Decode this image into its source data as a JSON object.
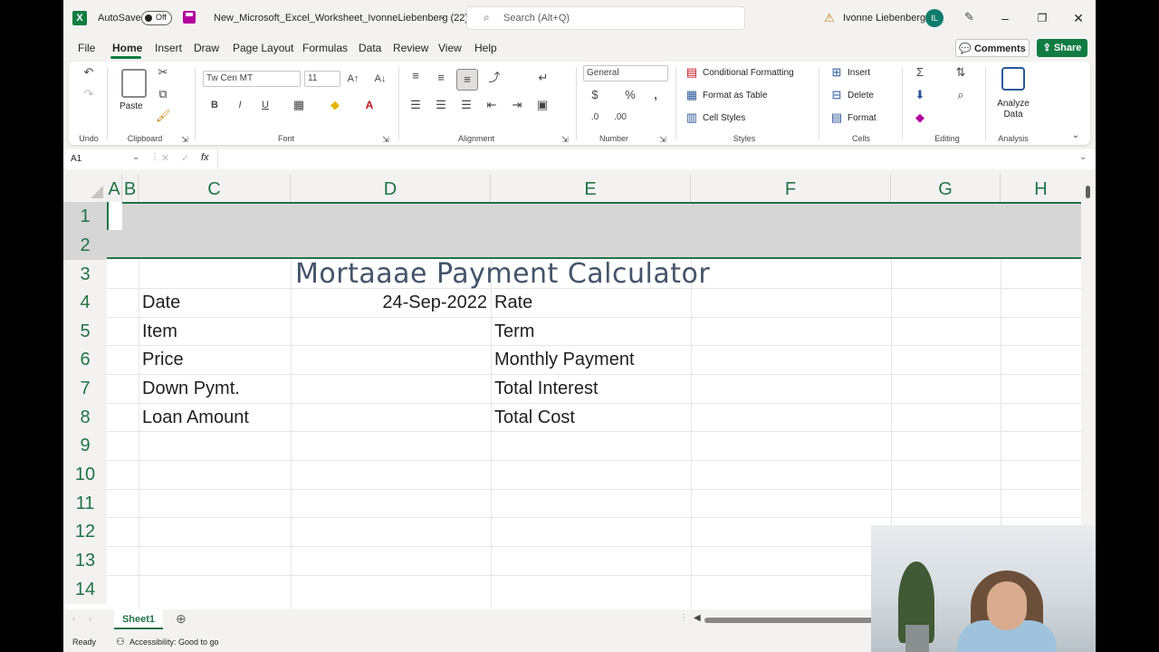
{
  "titlebar": {
    "autosave_label": "AutoSave",
    "autosave_state": "Off",
    "filename": "New_Microsoft_Excel_Worksheet_IvonneLiebenberg (22)",
    "search_placeholder": "Search (Alt+Q)",
    "user_name": "Ivonne Liebenberg",
    "avatar_initials": "IL"
  },
  "menu": {
    "items": [
      "File",
      "Home",
      "Insert",
      "Draw",
      "Page Layout",
      "Formulas",
      "Data",
      "Review",
      "View",
      "Help"
    ],
    "active": "Home",
    "comments_label": "Comments",
    "share_label": "Share"
  },
  "ribbon": {
    "groups": {
      "undo": "Undo",
      "clipboard": "Clipboard",
      "font": "Font",
      "alignment": "Alignment",
      "number": "Number",
      "styles": "Styles",
      "cells": "Cells",
      "editing": "Editing",
      "analysis": "Analysis"
    },
    "paste_label": "Paste",
    "font_name": "Tw Cen MT",
    "font_size": "11",
    "number_format": "General",
    "conditional_formatting": "Conditional Formatting",
    "format_as_table": "Format as Table",
    "cell_styles": "Cell Styles",
    "insert": "Insert",
    "delete": "Delete",
    "format": "Format",
    "analyze_data": "Analyze Data"
  },
  "formula_bar": {
    "name_box": "A1",
    "fx": "fx",
    "content": ""
  },
  "sheet": {
    "columns": [
      "A",
      "B",
      "C",
      "D",
      "E",
      "F",
      "G",
      "H"
    ],
    "rows": [
      "1",
      "2",
      "3",
      "4",
      "5",
      "6",
      "7",
      "8",
      "9",
      "10",
      "11",
      "12",
      "13",
      "14"
    ],
    "title": "Mortaaae Payment Calculator",
    "left_labels": [
      "Date",
      "Item",
      "Price",
      "Down Pymt.",
      "Loan Amount"
    ],
    "date_value": "24-Sep-2022",
    "right_labels": [
      "Rate",
      "Term",
      "Monthly Payment",
      "Total Interest",
      "Total Cost"
    ]
  },
  "sheet_tabs": {
    "active": "Sheet1"
  },
  "status": {
    "ready": "Ready",
    "accessibility": "Accessibility: Good to go"
  },
  "colors": {
    "excel_green": "#217346",
    "share_green": "#107c41",
    "title_slate": "#44546a"
  }
}
